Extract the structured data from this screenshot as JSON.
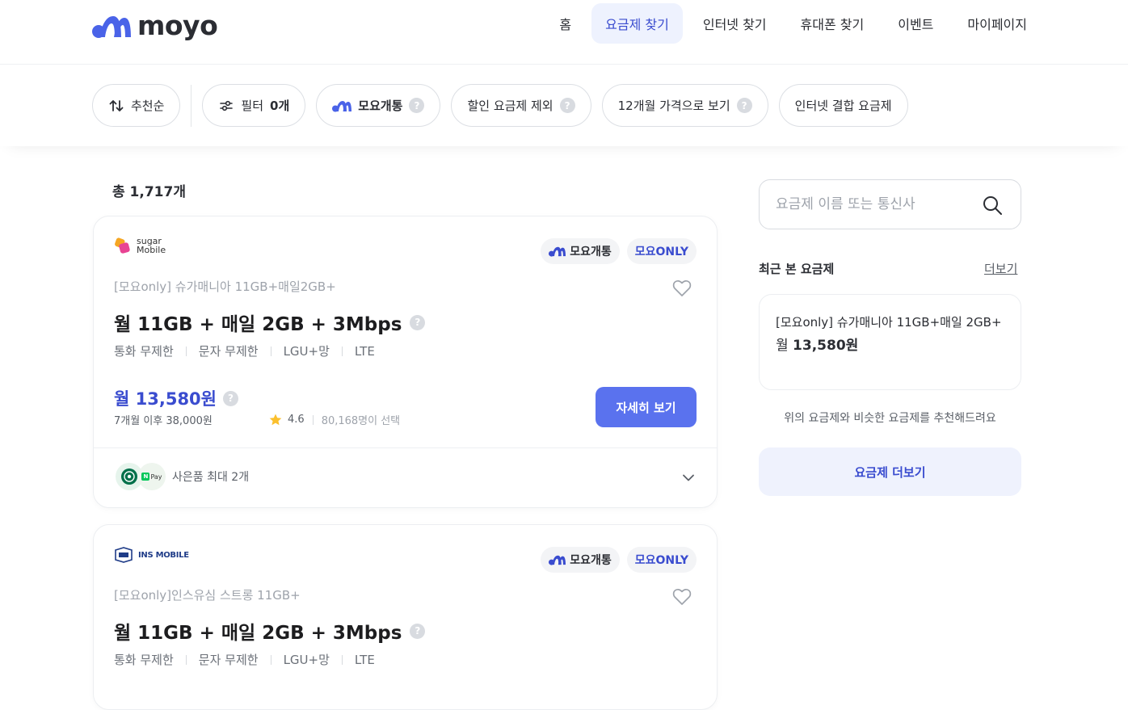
{
  "header": {
    "logo_text": "moyo",
    "nav": [
      {
        "label": "홈",
        "active": false
      },
      {
        "label": "요금제 찾기",
        "active": true
      },
      {
        "label": "인터넷 찾기",
        "active": false
      },
      {
        "label": "휴대폰 찾기",
        "active": false
      },
      {
        "label": "이벤트",
        "active": false
      },
      {
        "label": "마이페이지",
        "active": false
      }
    ]
  },
  "filters": {
    "sort_label": "추천순",
    "filter_label": "필터",
    "filter_count": "0개",
    "moyo_tong": "모요개통",
    "exclude_discount": "할인 요금제 제외",
    "twelve_month": "12개월 가격으로 보기",
    "internet_combo": "인터넷 결합 요금제",
    "help_icon": "?"
  },
  "total_label": "총 1,717개",
  "plans": [
    {
      "carrier_logo_line1": "sugar",
      "carrier_logo_line2": "Mobile",
      "badge_tong": "모요개통",
      "badge_only": "모요ONLY",
      "subtitle": "[모요only] 슈가매니아 11GB+매일2GB+",
      "title": "월 11GB + 매일 2GB + 3Mbps",
      "specs": [
        "통화 무제한",
        "문자 무제한",
        "LGU+망",
        "LTE"
      ],
      "price": "월 13,580원",
      "price_after": "7개월 이후 38,000원",
      "rating": "4.6",
      "selected": "80,168명이 선택",
      "detail_button": "자세히 보기",
      "gift_text": "사은품 최대 2개",
      "gift_pay_label": "Pay"
    },
    {
      "carrier_logo_text": "INS MOBILE",
      "badge_tong": "모요개통",
      "badge_only": "모요ONLY",
      "subtitle": "[모요only]인스유심 스트롱 11GB+",
      "title": "월 11GB + 매일 2GB + 3Mbps",
      "specs": [
        "통화 무제한",
        "문자 무제한",
        "LGU+망",
        "LTE"
      ]
    }
  ],
  "sidebar": {
    "search_placeholder": "요금제 이름 또는 통신사",
    "recent_title": "최근 본 요금제",
    "more_link": "더보기",
    "recent_plan_name": "[모요only] 슈가매니아 11GB+매일 2GB+",
    "recent_plan_price_prefix": "월 ",
    "recent_plan_price": "13,580원",
    "recommend_note": "위의 요금제와 비슷한 요금제를 추천해드려요",
    "more_plans_button": "요금제 더보기"
  },
  "colors": {
    "accent": "#3a4ccf",
    "button": "#5a72ee",
    "active_nav_bg": "#eef2fe"
  }
}
